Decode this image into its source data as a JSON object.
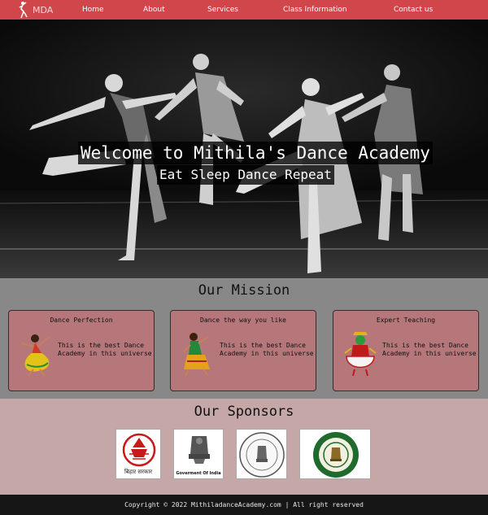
{
  "nav": {
    "brand": "MDA",
    "links": [
      "Home",
      "About",
      "Services",
      "Class Information",
      "Contact us"
    ]
  },
  "hero": {
    "title": "Welcome to Mithila's Dance Academy",
    "subtitle": "Eat Sleep Dance Repeat"
  },
  "mission": {
    "title": "Our Mission",
    "cards": [
      {
        "title": "Dance Perfection",
        "text": "This is the best Dance Academy in this universe"
      },
      {
        "title": "Dance the way you like",
        "text": "This is the best Dance Academy in this universe"
      },
      {
        "title": "Expert Teaching",
        "text": "This is the best Dance Academy in this universe"
      }
    ]
  },
  "sponsors": {
    "title": "Our Sponsors",
    "bihar_caption": "बिहार सरकार",
    "india_caption": "Goverment Of India"
  },
  "footer": {
    "text": "Copyright © 2022 MithiladanceAcademy.com | All right reserved"
  },
  "colors": {
    "nav": "#d1464b",
    "mission_bg": "#888888",
    "card_bg": "#b5777a",
    "sponsors_bg": "#c6a7a7",
    "footer_bg": "#161616"
  }
}
